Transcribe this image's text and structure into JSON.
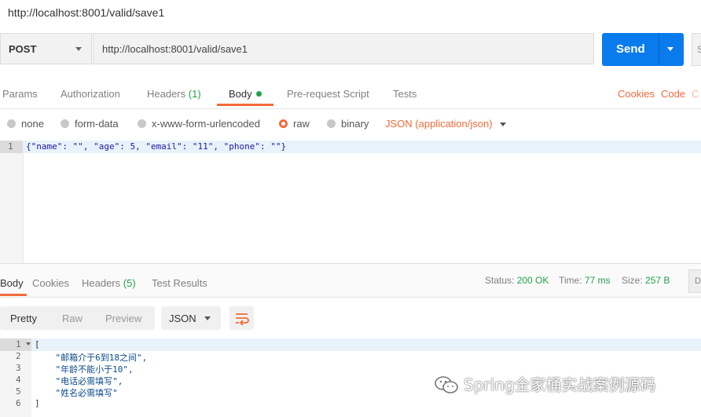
{
  "window": {
    "title": "http://localhost:8001/valid/save1"
  },
  "request": {
    "method": "POST",
    "url": "http://localhost:8001/valid/save1",
    "send_label": "Send",
    "save_stub": "S"
  },
  "request_tabs": {
    "params": "Params",
    "authorization": "Authorization",
    "headers": "Headers",
    "headers_count": "(1)",
    "body": "Body",
    "prerequest": "Pre-request Script",
    "tests": "Tests",
    "cookies": "Cookies",
    "code": "Code",
    "more_stub": "C"
  },
  "body_types": {
    "none": "none",
    "form_data": "form-data",
    "urlencoded": "x-www-form-urlencoded",
    "raw": "raw",
    "binary": "binary",
    "content_type": "JSON (application/json)",
    "selected": "raw"
  },
  "request_body": {
    "line_number": "1",
    "code": "{\"name\": \"\", \"age\": 5, \"email\": \"11\", \"phone\": \"\"}"
  },
  "response_tabs": {
    "body": "Body",
    "cookies": "Cookies",
    "headers": "Headers",
    "headers_count": "(5)",
    "test_results": "Test Results"
  },
  "response_status": {
    "status_label": "Status:",
    "status_value": "200 OK",
    "time_label": "Time:",
    "time_value": "77 ms",
    "size_label": "Size:",
    "size_value": "257 B",
    "stub": "D"
  },
  "view_toolbar": {
    "pretty": "Pretty",
    "raw": "Raw",
    "preview": "Preview",
    "format": "JSON"
  },
  "response_body": {
    "lines": [
      {
        "num": "1",
        "text": "["
      },
      {
        "num": "2",
        "text": "    \"邮箱介于6到18之间\","
      },
      {
        "num": "3",
        "text": "    \"年龄不能小于10\","
      },
      {
        "num": "4",
        "text": "    \"电话必需填写\","
      },
      {
        "num": "5",
        "text": "    \"姓名必需填写\""
      },
      {
        "num": "6",
        "text": "]"
      }
    ]
  },
  "watermark": {
    "text": "Spring全家桶实战案例源码"
  },
  "colors": {
    "accent": "#f26b3a",
    "send_blue": "#097bed",
    "success_green": "#24a148"
  }
}
